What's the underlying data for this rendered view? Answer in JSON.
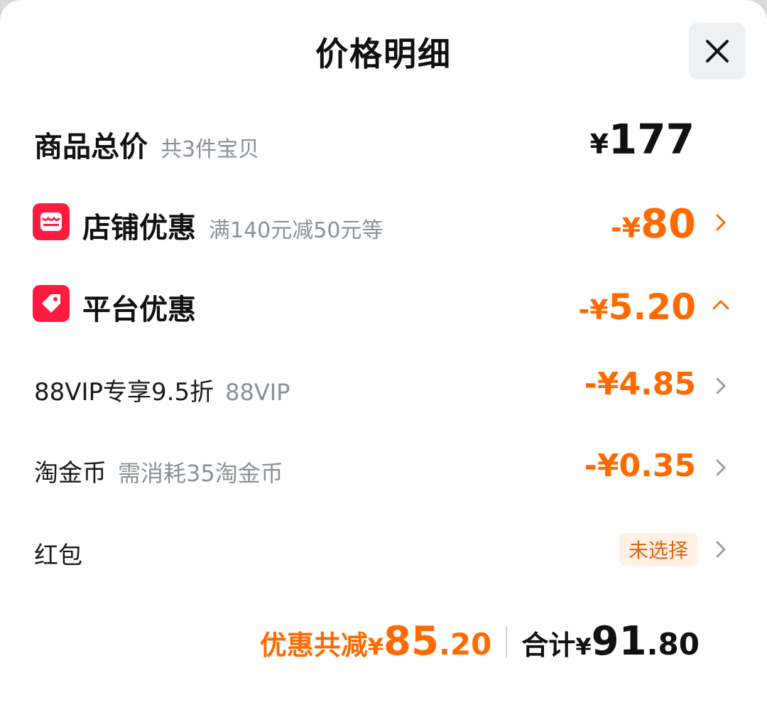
{
  "header": {
    "title": "价格明细"
  },
  "goods_total": {
    "label": "商品总价",
    "sub": "共3件宝贝",
    "currency": "¥",
    "amount": "177"
  },
  "store_discount": {
    "label": "店铺优惠",
    "sub": "满140元减50元等",
    "prefix": "-¥",
    "amount": "80"
  },
  "platform_discount": {
    "label": "平台优惠",
    "prefix": "-¥",
    "amount": "5.20"
  },
  "vip": {
    "label": "88VIP专享9.5折",
    "sub": "88VIP",
    "amount": "-¥4.85"
  },
  "coins": {
    "label": "淘金币",
    "sub": "需消耗35淘金币",
    "amount": "-¥0.35"
  },
  "red_packet": {
    "label": "红包",
    "status": "未选择"
  },
  "footer": {
    "discount_label": "优惠共减",
    "discount_currency": "¥",
    "discount_int": "85",
    "discount_dec": ".20",
    "total_label": "合计",
    "total_currency": "¥",
    "total_int": "91",
    "total_dec": ".80"
  },
  "colors": {
    "accent": "#ff6a00",
    "icon_red": "#ff1a40",
    "text": "#111111",
    "muted": "#8a8f99"
  }
}
